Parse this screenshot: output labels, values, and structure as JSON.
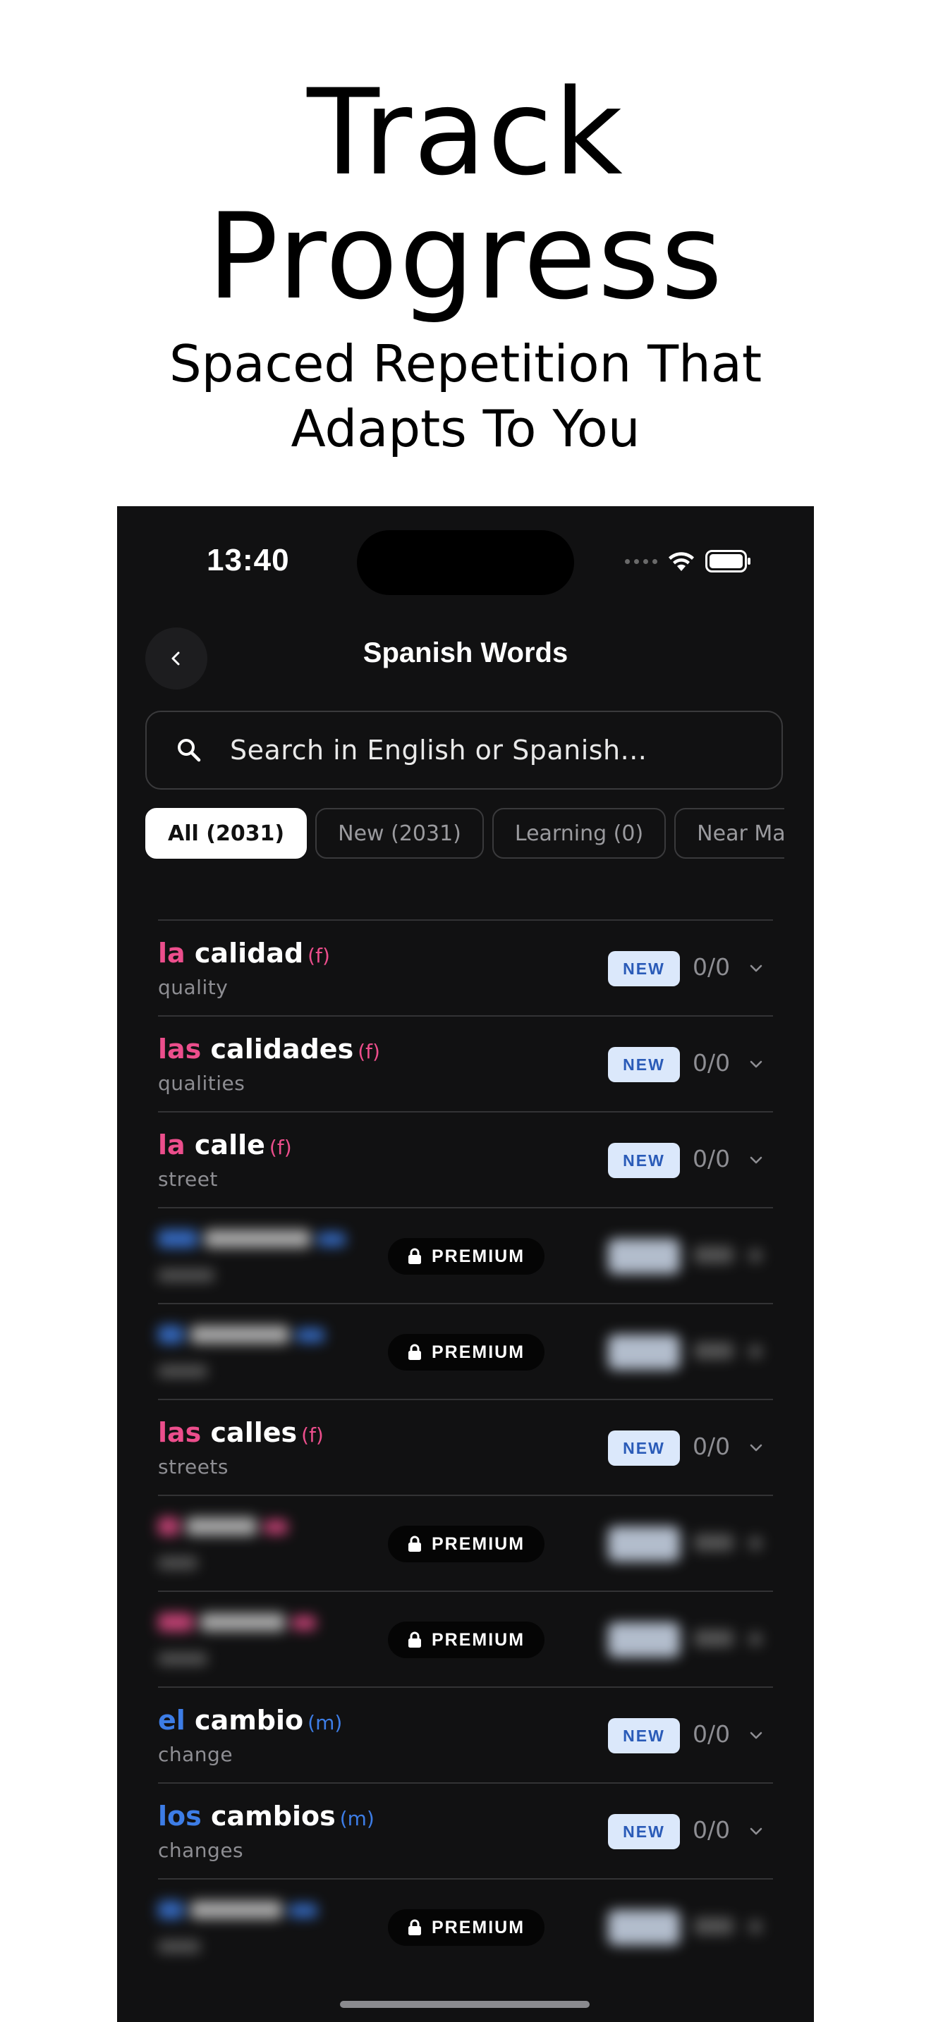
{
  "hero": {
    "title_line1": "Track",
    "title_line2": "Progress",
    "subtitle_line1": "Spaced Repetition That",
    "subtitle_line2": "Adapts To You"
  },
  "status_bar": {
    "time": "13:40"
  },
  "nav": {
    "title": "Spanish Words",
    "back_icon": "chevron-left-icon"
  },
  "search": {
    "placeholder": "Search in English or Spanish...",
    "value": ""
  },
  "filters": [
    {
      "label": "All (2031)",
      "active": true
    },
    {
      "label": "New (2031)",
      "active": false
    },
    {
      "label": "Learning (0)",
      "active": false
    },
    {
      "label": "Near Mas",
      "active": false
    }
  ],
  "words": [
    {
      "article": "la",
      "word": "calidad",
      "gender": "(f)",
      "translation": "quality",
      "badge": "NEW",
      "score": "0/0"
    },
    {
      "article": "las",
      "word": "calidades",
      "gender": "(f)",
      "translation": "qualities",
      "badge": "NEW",
      "score": "0/0"
    },
    {
      "article": "la",
      "word": "calle",
      "gender": "(f)",
      "translation": "street",
      "badge": "NEW",
      "score": "0/0"
    },
    {
      "premium_label": "PREMIUM"
    },
    {
      "premium_label": "PREMIUM"
    },
    {
      "article": "las",
      "word": "calles",
      "gender": "(f)",
      "translation": "streets",
      "badge": "NEW",
      "score": "0/0"
    },
    {
      "premium_label": "PREMIUM"
    },
    {
      "premium_label": "PREMIUM"
    },
    {
      "article": "el",
      "word": "cambio",
      "gender": "(m)",
      "translation": "change",
      "badge": "NEW",
      "score": "0/0"
    },
    {
      "article": "los",
      "word": "cambios",
      "gender": "(m)",
      "translation": "changes",
      "badge": "NEW",
      "score": "0/0"
    },
    {
      "premium_label": "PREMIUM"
    }
  ],
  "colors": {
    "feminine": "#ec4e8c",
    "masculine": "#3d7de6",
    "badge_bg": "#dbe8fb",
    "background": "#111112"
  }
}
